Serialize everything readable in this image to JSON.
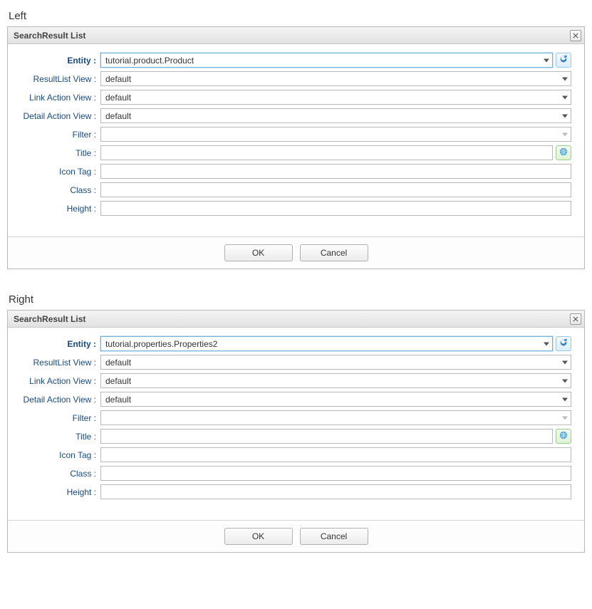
{
  "sections": {
    "left": {
      "title": "Left",
      "panelTitle": "SearchResult List",
      "fields": {
        "entity": {
          "label": "Entity :",
          "value": "tutorial.product.Product"
        },
        "resultListView": {
          "label": "ResultList View :",
          "value": "default"
        },
        "linkActionView": {
          "label": "Link Action View :",
          "value": "default"
        },
        "detailActionView": {
          "label": "Detail Action View :",
          "value": "default"
        },
        "filter": {
          "label": "Filter :",
          "value": ""
        },
        "titleField": {
          "label": "Title :",
          "value": ""
        },
        "iconTag": {
          "label": "Icon Tag :",
          "value": ""
        },
        "class": {
          "label": "Class :",
          "value": ""
        },
        "height": {
          "label": "Height :",
          "value": ""
        }
      },
      "buttons": {
        "ok": "OK",
        "cancel": "Cancel"
      }
    },
    "right": {
      "title": "Right",
      "panelTitle": "SearchResult List",
      "fields": {
        "entity": {
          "label": "Entity :",
          "value": "tutorial.properties.Properties2"
        },
        "resultListView": {
          "label": "ResultList View :",
          "value": "default"
        },
        "linkActionView": {
          "label": "Link Action View :",
          "value": "default"
        },
        "detailActionView": {
          "label": "Detail Action View :",
          "value": "default"
        },
        "filter": {
          "label": "Filter :",
          "value": ""
        },
        "titleField": {
          "label": "Title :",
          "value": ""
        },
        "iconTag": {
          "label": "Icon Tag :",
          "value": ""
        },
        "class": {
          "label": "Class :",
          "value": ""
        },
        "height": {
          "label": "Height :",
          "value": ""
        }
      },
      "buttons": {
        "ok": "OK",
        "cancel": "Cancel"
      }
    }
  }
}
